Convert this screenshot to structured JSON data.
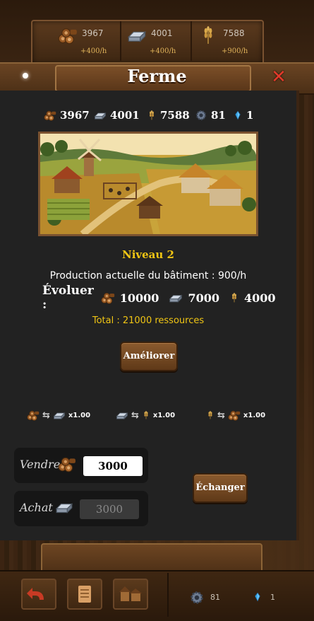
{
  "topbar": {
    "wood": {
      "value": "3967",
      "rate": "+400/h"
    },
    "iron": {
      "value": "4001",
      "rate": "+400/h"
    },
    "wheat": {
      "value": "7588",
      "rate": "+900/h"
    }
  },
  "header": {
    "title": "Ferme"
  },
  "resources": {
    "wood": "3967",
    "iron": "4001",
    "wheat": "7588",
    "gear": "81",
    "crystal": "1"
  },
  "building": {
    "level": "Niveau 2",
    "production": "Production actuelle du bâtiment : 900/h",
    "upgrade_label": "Évoluer :",
    "cost_wood": "10000",
    "cost_iron": "7000",
    "cost_wheat": "4000",
    "total": "Total : 21000 ressources",
    "upgrade_button": "Améliorer"
  },
  "exchange": {
    "rate1": "x1.00",
    "rate2": "x1.00",
    "rate3": "x1.00",
    "sell_label": "Vendre",
    "sell_value": "3000",
    "buy_label": "Achat",
    "buy_value": "3000",
    "button": "Échanger"
  },
  "bottombar": {
    "gear": "81",
    "crystal": "1"
  },
  "icons": {
    "wood": "wood-logs-icon",
    "iron": "iron-ingot-icon",
    "wheat": "wheat-icon",
    "gear": "gear-icon",
    "crystal": "crystal-icon"
  },
  "colors": {
    "level": "#f0c514",
    "panel": "#222222",
    "button": "#8a5a2e"
  }
}
